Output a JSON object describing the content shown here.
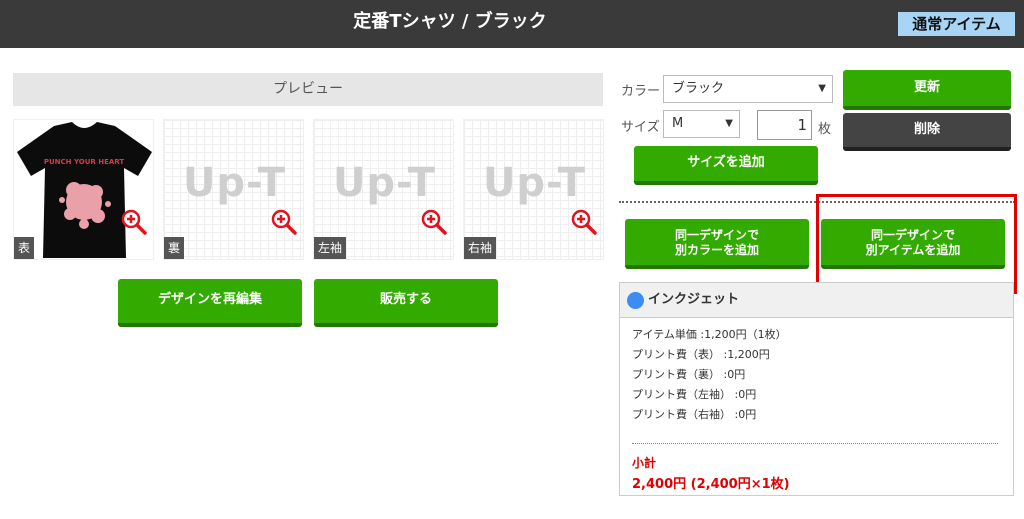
{
  "header": {
    "title": "定番Tシャツ / ブラック",
    "badge": "通常アイテム"
  },
  "preview": {
    "heading": "プレビュー",
    "watermark": "Up-T",
    "tshirt_print_text": "PUNCH YOUR HEART",
    "thumbnails": [
      {
        "label": "表"
      },
      {
        "label": "裏"
      },
      {
        "label": "左袖"
      },
      {
        "label": "右袖"
      }
    ],
    "buttons": {
      "redesign": "デザインを再編集",
      "sell": "販売する"
    }
  },
  "options": {
    "color_label": "カラー",
    "color_value": "ブラック",
    "size_label": "サイズ",
    "size_value": "M",
    "quantity": "1",
    "quantity_unit": "枚",
    "add_size": "サイズを追加",
    "update": "更新",
    "delete": "削除",
    "same_design_other_color_line1": "同一デザインで",
    "same_design_other_color_line2": "別カラーを追加",
    "same_design_other_item_line1": "同一デザインで",
    "same_design_other_item_line2": "別アイテムを追加"
  },
  "inkjet": {
    "title": "インクジェット",
    "lines": [
      "アイテム単価 :1,200円（1枚）",
      "プリント費（表） :1,200円",
      "プリント費（裏） :0円",
      "プリント費（左袖） :0円",
      "プリント費（右袖） :0円"
    ],
    "subtotal_label": "小計",
    "subtotal_value": "2,400円 (2,400円×1枚)"
  },
  "colors": {
    "accent_green": "#33aa00",
    "header_bg": "#3a3a3a",
    "badge_bg": "#a8d4f5",
    "highlight_red": "#e00000",
    "price_red": "#e00000"
  }
}
